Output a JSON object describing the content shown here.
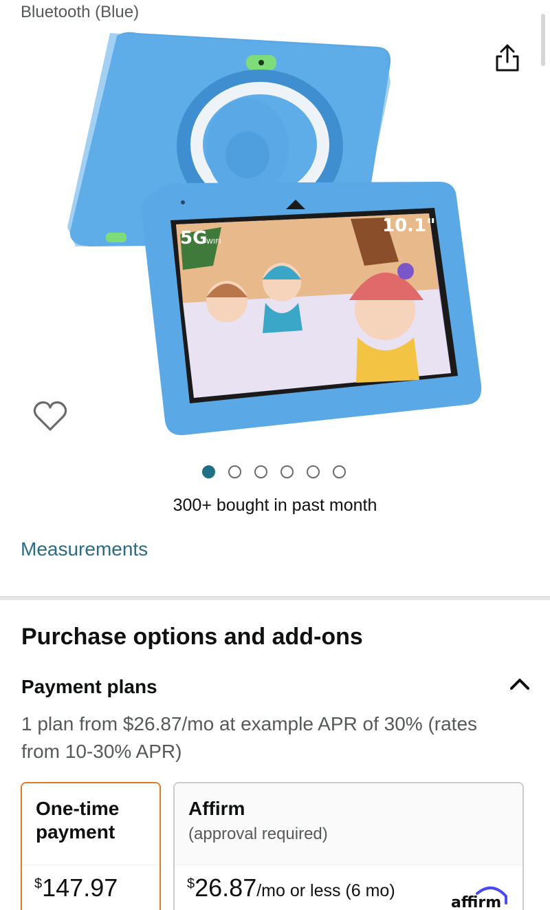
{
  "product": {
    "variant_title": "Bluetooth (Blue)",
    "image_alt": "Kids tablet in blue case with kickstand",
    "screen_badges": [
      "5G",
      "WIFI",
      "10.1\""
    ],
    "bought_text": "300+ bought in past month",
    "measurements_link": "Measurements",
    "image_count": 6,
    "active_image_index": 0
  },
  "purchase": {
    "title": "Purchase options and add-ons",
    "payment_plans_title": "Payment plans",
    "payment_plans_desc": "1 plan from $26.87/mo at example APR of 30% (rates from 10-30% APR)",
    "options": [
      {
        "title": "One-time payment",
        "subtitle": "",
        "currency": "$",
        "price": "147.97",
        "suffix": "",
        "selected": true
      },
      {
        "title": "Affirm",
        "subtitle": "(approval required)",
        "currency": "$",
        "price": "26.87",
        "suffix": "/mo or less (6 mo)",
        "selected": false,
        "logo_text": "affirm"
      }
    ]
  },
  "icons": {
    "share": "share-icon",
    "wishlist": "heart-icon",
    "collapse": "chevron-up-icon"
  },
  "colors": {
    "link": "#2a6c85",
    "selected_border": "#e07b24",
    "active_dot": "#1f6f86",
    "affirm_logo": "#4a4af4"
  }
}
